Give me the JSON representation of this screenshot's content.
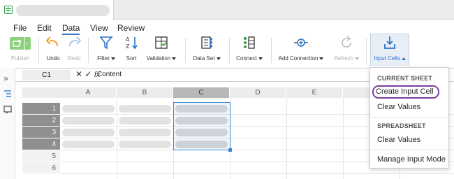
{
  "menu": {
    "items": [
      "File",
      "Edit",
      "Data",
      "View",
      "Review"
    ],
    "active": "Data"
  },
  "toolbar": {
    "publish": "Publish",
    "undo": "Undo",
    "redo": "Redo",
    "filter": "Filter",
    "sort": "Sort",
    "validation": "Validation",
    "dataset": "Data Set",
    "connect": "Connect",
    "add_connection": "Add Connection",
    "refresh": "Refresh",
    "input_cells": "Input Cells"
  },
  "formula": {
    "cell_ref": "C1",
    "value": "Content"
  },
  "grid": {
    "columns": [
      "A",
      "B",
      "C",
      "D",
      "E"
    ],
    "selected_column": "C",
    "rows": [
      "1",
      "2",
      "3",
      "4",
      "5",
      "6"
    ],
    "selected_rows": [
      "1",
      "2",
      "3",
      "4"
    ]
  },
  "dropdown": {
    "current_sheet_header": "CURRENT SHEET",
    "create_input_cell": "Create Input Cell",
    "clear_values_sheet": "Clear Values",
    "spreadsheet_header": "SPREADSHEET",
    "clear_values_spreadsheet": "Clear Values",
    "manage_input_mode": "Manage Input Mode"
  },
  "colors": {
    "accent": "#2a73c8",
    "selection": "#3a86d4",
    "highlight_ring": "#7a3fa0",
    "publish_green": "#8fd07f"
  }
}
